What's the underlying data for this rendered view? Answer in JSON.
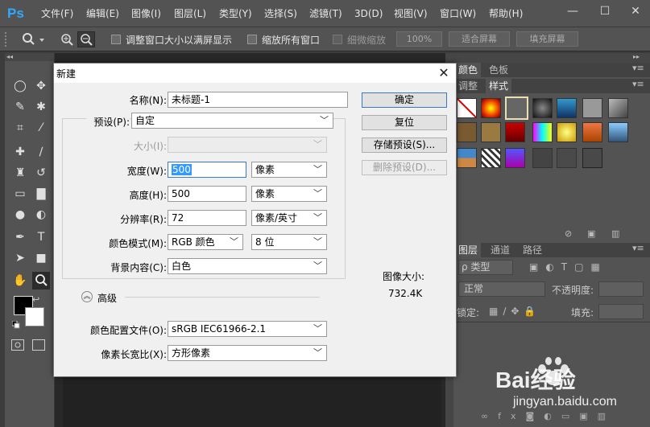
{
  "app": {
    "logo": "Ps"
  },
  "menu": [
    "文件(F)",
    "编辑(E)",
    "图像(I)",
    "图层(L)",
    "类型(Y)",
    "选择(S)",
    "滤镜(T)",
    "3D(D)",
    "视图(V)",
    "窗口(W)",
    "帮助(H)"
  ],
  "window_controls": {
    "minimize": "—",
    "maximize": "☐",
    "close": "✕"
  },
  "options_bar": {
    "resize_windows": "调整窗口大小以满屏显示",
    "zoom_all": "缩放所有窗口",
    "scrubby": "细微缩放",
    "zoom_pct": "100%",
    "fit_screen": "适合屏幕",
    "fill_screen": "填充屏幕"
  },
  "panels": {
    "color_tab": "颜色",
    "swatch_tab": "色板",
    "adjust_tab": "调整",
    "style_tab": "样式",
    "layers_tab": "图层",
    "channels_tab": "通道",
    "paths_tab": "路径",
    "kind_filter": "ρ 类型",
    "blend_mode": "正常",
    "opacity_label": "不透明度:",
    "lock_label": "锁定:",
    "fill_label": "填充:"
  },
  "dialog": {
    "title": "新建",
    "name_label": "名称(N):",
    "name_value": "未标题-1",
    "preset_label": "预设(P):",
    "preset_value": "自定",
    "size_label": "大小(I):",
    "width_label": "宽度(W):",
    "width_value": "500",
    "width_unit": "像素",
    "height_label": "高度(H):",
    "height_value": "500",
    "height_unit": "像素",
    "resolution_label": "分辨率(R):",
    "resolution_value": "72",
    "resolution_unit": "像素/英寸",
    "color_mode_label": "颜色模式(M):",
    "color_mode_value": "RGB 颜色",
    "bit_depth_value": "8 位",
    "background_label": "背景内容(C):",
    "background_value": "白色",
    "advanced_label": "高级",
    "color_profile_label": "颜色配置文件(O):",
    "color_profile_value": "sRGB IEC61966-2.1",
    "pixel_aspect_label": "像素长宽比(X):",
    "pixel_aspect_value": "方形像素",
    "ok_button": "确定",
    "reset_button": "复位",
    "save_preset_button": "存储预设(S)...",
    "delete_preset_button": "删除预设(D)...",
    "image_size_label": "图像大小:",
    "image_size_value": "732.4K"
  },
  "watermark": {
    "brand": "Bai经验",
    "url": "jingyan.baidu.com"
  },
  "colors": {
    "ui_dark": "#535353",
    "accent_blue": "#3b79c4",
    "ps_blue": "#31a8ff"
  }
}
